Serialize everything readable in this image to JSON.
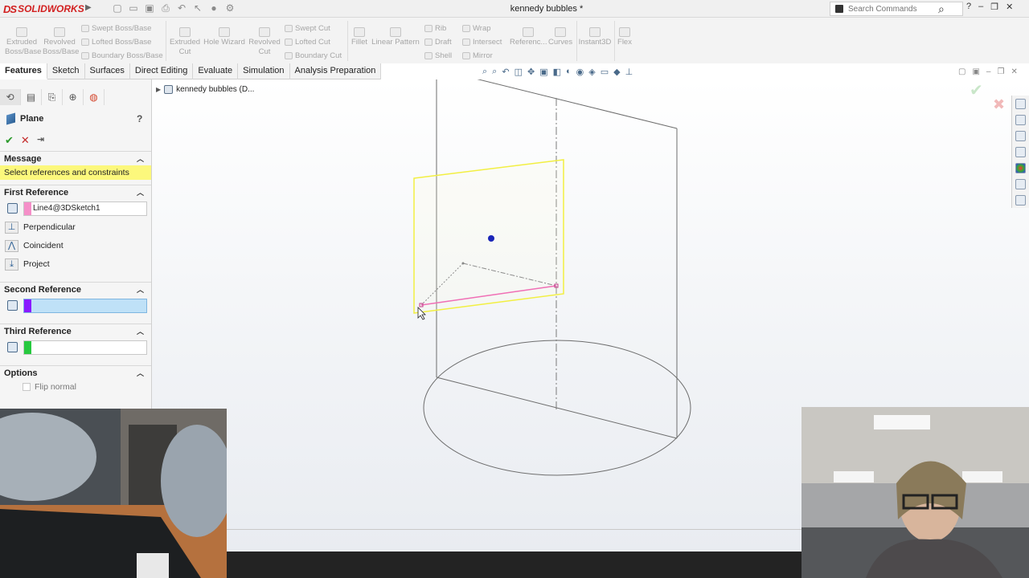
{
  "app": {
    "brand": "SOLIDWORKS",
    "brand_prefix": "DS",
    "document_title": "kennedy bubbles *"
  },
  "search": {
    "placeholder": "Search Commands"
  },
  "ribbon": {
    "big_buttons": [
      {
        "label": "Extruded Boss/Base",
        "icon": "extrude-icon"
      },
      {
        "label": "Revolved Boss/Base",
        "icon": "revolve-icon"
      },
      {
        "label": "Extruded Cut",
        "icon": "extruded-cut-icon"
      },
      {
        "label": "Hole Wizard",
        "icon": "hole-wizard-icon"
      },
      {
        "label": "Revolved Cut",
        "icon": "revolved-cut-icon"
      },
      {
        "label": "Fillet",
        "icon": "fillet-icon"
      },
      {
        "label": "Linear Pattern",
        "icon": "linear-pattern-icon"
      },
      {
        "label": "Referenc...",
        "icon": "reference-geometry-icon"
      },
      {
        "label": "Curves",
        "icon": "curves-icon"
      },
      {
        "label": "Instant3D",
        "icon": "instant3d-icon"
      },
      {
        "label": "Flex",
        "icon": "flex-icon"
      }
    ],
    "small_buttons": [
      {
        "label": "Swept Boss/Base"
      },
      {
        "label": "Lofted Boss/Base"
      },
      {
        "label": "Boundary Boss/Base"
      },
      {
        "label": "Swept Cut"
      },
      {
        "label": "Lofted Cut"
      },
      {
        "label": "Boundary Cut"
      },
      {
        "label": "Rib"
      },
      {
        "label": "Draft"
      },
      {
        "label": "Shell"
      },
      {
        "label": "Wrap"
      },
      {
        "label": "Intersect"
      },
      {
        "label": "Mirror"
      }
    ]
  },
  "tabs": [
    {
      "label": "Features",
      "active": true
    },
    {
      "label": "Sketch"
    },
    {
      "label": "Surfaces"
    },
    {
      "label": "Direct Editing"
    },
    {
      "label": "Evaluate"
    },
    {
      "label": "Simulation"
    },
    {
      "label": "Analysis Preparation"
    }
  ],
  "property_manager": {
    "title": "Plane",
    "help": "?",
    "message_header": "Message",
    "message": "Select references and constraints",
    "first_reference": {
      "header": "First Reference",
      "value": "Line4@3DSketch1",
      "color": "#f58fc8",
      "options": [
        "Perpendicular",
        "Coincident",
        "Project"
      ]
    },
    "second_reference": {
      "header": "Second Reference",
      "value": "",
      "color": "#8a1aff"
    },
    "third_reference": {
      "header": "Third Reference",
      "value": "",
      "color": "#27c93f"
    },
    "options": {
      "header": "Options",
      "flip_normal": "Flip normal"
    }
  },
  "feature_tree": {
    "item": "kennedy bubbles  (D..."
  },
  "colors": {
    "plane_preview": "#f2ef42",
    "reference_line": "#f06fb5",
    "origin_dot": "#1a25b8",
    "accent_ok": "#2c9a2c",
    "accent_cancel": "#c42a2a"
  }
}
